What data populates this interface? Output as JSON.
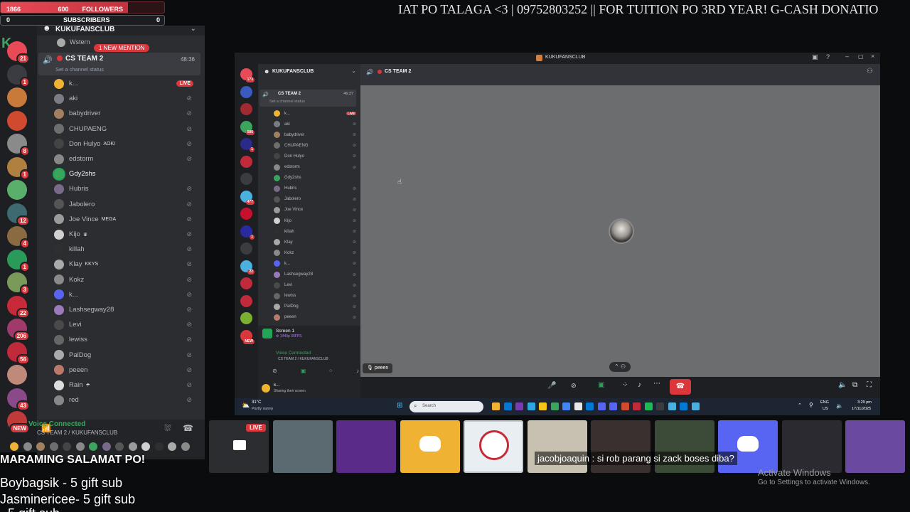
{
  "overlay": {
    "followers": {
      "current": "1866",
      "label": "FOLLOWERS",
      "goal": "600",
      "progress": 0.78
    },
    "subscribers": {
      "current": "0",
      "label": "SUBSCRIBERS",
      "goal": "0"
    },
    "ticker": "IAT PO TALAGA <3  | 09752803252 || FOR TUITION PO 3RD YEAR! G-CASH DONATIO",
    "thanks": "MARAMING SALAMAT PO!",
    "gifts": [
      "Boybagsik - 5 gift sub",
      "Jasminericee- 5 gift sub",
      "- 5 gift sub"
    ],
    "chat_message": "jacobjoaquin : si rob parang si zack boses diba?",
    "activate_title": "Activate Windows",
    "activate_sub": "Go to Settings to activate Windows."
  },
  "discord": {
    "server_name": "KUKUFANSCLUB",
    "mention_badge": "1 NEW MENTION",
    "previous_user": "Wstern",
    "voice_channel": {
      "name": "CS TEAM 2",
      "timer": "48:36",
      "status": "Set a channel status"
    },
    "members": [
      {
        "name": "k...",
        "live": "LIVE",
        "color": "#f0b232"
      },
      {
        "name": "aki",
        "color": "#7a7d85"
      },
      {
        "name": "babydriver",
        "color": "#a08060"
      },
      {
        "name": "CHUPAENG",
        "color": "#6e6e6e"
      },
      {
        "name": "Don Hulyo",
        "tag": "AOKI",
        "color": "#444"
      },
      {
        "name": "edstorm",
        "color": "#888"
      },
      {
        "name": "Gdy2shs",
        "color": "#3ba55d",
        "speaking": true
      },
      {
        "name": "Hubris",
        "color": "#7a6a8a"
      },
      {
        "name": "Jabolero",
        "color": "#555"
      },
      {
        "name": "Joe Vince",
        "tag": "MEGA",
        "color": "#9b9b9b"
      },
      {
        "name": "Kijo",
        "tag": "♛",
        "color": "#d0d0d0"
      },
      {
        "name": "killah",
        "color": "#2f2f2f"
      },
      {
        "name": "Klay",
        "tag": "KKYS",
        "color": "#aaa"
      },
      {
        "name": "Kokz",
        "color": "#8a8a8a"
      },
      {
        "name": "k...",
        "color": "#5865f2"
      },
      {
        "name": "Lashsegway28",
        "color": "#9a7ab8"
      },
      {
        "name": "Levi",
        "color": "#4a4a4a"
      },
      {
        "name": "lewiss",
        "color": "#666"
      },
      {
        "name": "PalDog",
        "color": "#aaa"
      },
      {
        "name": "peeen",
        "color": "#b97a6a"
      },
      {
        "name": "Rain",
        "tag": "☂",
        "color": "#ddd"
      },
      {
        "name": "red",
        "color": "#888"
      }
    ],
    "voice_connected": "Voice Connected",
    "voice_location": "CS TEAM 2 / KUKUFANSCLUB",
    "guild_badges": [
      "21",
      "1",
      "",
      "",
      "8",
      "1",
      "",
      "12",
      "4",
      "1",
      "3",
      "22",
      "206",
      "56",
      "",
      "43",
      "NEW"
    ]
  },
  "window": {
    "title": "KUKUFANSCLUB",
    "header_channel": "CS TEAM 2",
    "inner_timer": "46:37",
    "inner_status": "Set a channel status",
    "screen_share": {
      "title": "Screen 1",
      "sub": "⚙ 1440p 30FPS"
    },
    "voice_connected": "Voice Connected",
    "voice_location": "CS TEAM 2 / KUKUFANSCLUB",
    "user_name": "k...",
    "user_status": "Sharing their screen",
    "stage_label": "peeen",
    "weather_temp": "31°C",
    "weather_desc": "Partly sunny",
    "search_placeholder": "Search",
    "lang": "ENG",
    "region": "US",
    "time": "3:29 pm",
    "date": "17/11/2025",
    "inner_guild_badges": [
      "173",
      "",
      "",
      "586",
      "1",
      "",
      "",
      "477",
      "",
      "1",
      "",
      "22",
      "",
      "",
      "",
      "NEW"
    ],
    "inner_members": [
      "k...",
      "aki",
      "babydriver",
      "CHUPAENG",
      "Don Hulyo",
      "edstorm",
      "Gdy2shs",
      "Hubris",
      "Jabolero",
      "Joe Vince",
      "Kijo",
      "killah",
      "Klay",
      "Kokz",
      "k...",
      "Lashsegway28",
      "Levi",
      "lewiss",
      "PalDog",
      "peeen"
    ]
  },
  "thumbnails": {
    "live_badge": "LIVE",
    "tiles": [
      {
        "name": "screen-share-tile",
        "bg": "#2b2d31"
      },
      {
        "name": "camera-tile",
        "bg": "#5a6a70"
      },
      {
        "name": "anime-avatar-tile",
        "bg": "#5b2b8a"
      },
      {
        "name": "discord-yellow-tile",
        "bg": "#f0b232"
      },
      {
        "name": "baymax-tile",
        "bg": "#e8eef2"
      },
      {
        "name": "webcam-tile",
        "bg": "#c8c0b0"
      },
      {
        "name": "boxer-tile",
        "bg": "#3a3030"
      },
      {
        "name": "outdoor-avatar-tile",
        "bg": "#3c4a38"
      },
      {
        "name": "discord-blue-tile",
        "bg": "#5865f2"
      },
      {
        "name": "dark-figure-tile",
        "bg": "#2a2a30"
      },
      {
        "name": "colorful-tile",
        "bg": "#6a4aa0"
      }
    ]
  }
}
